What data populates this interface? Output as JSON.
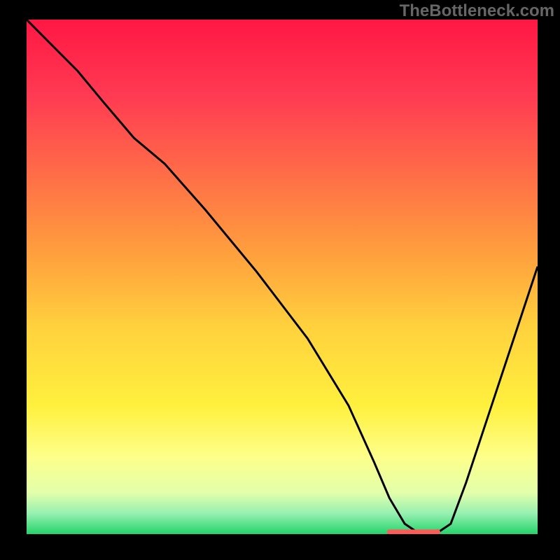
{
  "watermark": "TheBottleneck.com",
  "chart_data": {
    "type": "line",
    "title": "",
    "xlabel": "",
    "ylabel": "",
    "xlim": [
      0,
      100
    ],
    "ylim": [
      0,
      100
    ],
    "gradient_stops": [
      {
        "offset": 0,
        "color": "#ff1744"
      },
      {
        "offset": 15,
        "color": "#ff3b52"
      },
      {
        "offset": 45,
        "color": "#ff9e3d"
      },
      {
        "offset": 60,
        "color": "#ffd23d"
      },
      {
        "offset": 75,
        "color": "#fff03d"
      },
      {
        "offset": 85,
        "color": "#fdff8a"
      },
      {
        "offset": 92,
        "color": "#e2ffab"
      },
      {
        "offset": 96,
        "color": "#96f0b0"
      },
      {
        "offset": 100,
        "color": "#24d36a"
      }
    ],
    "series": [
      {
        "name": "bottleneck-curve",
        "color": "#000000",
        "x": [
          0,
          5,
          10,
          15,
          21,
          27,
          35,
          45,
          55,
          63,
          68,
          71,
          74,
          77,
          80,
          83,
          86,
          90,
          95,
          100
        ],
        "y": [
          100,
          95,
          90,
          84,
          77,
          72,
          63,
          51,
          38,
          25,
          14,
          7,
          2,
          0,
          0,
          2,
          10,
          22,
          37,
          52
        ]
      }
    ],
    "marker": {
      "color": "#ff5a5a",
      "x_start": 71,
      "x_end": 80,
      "y": 0.4,
      "end_dot_r": 4
    }
  }
}
